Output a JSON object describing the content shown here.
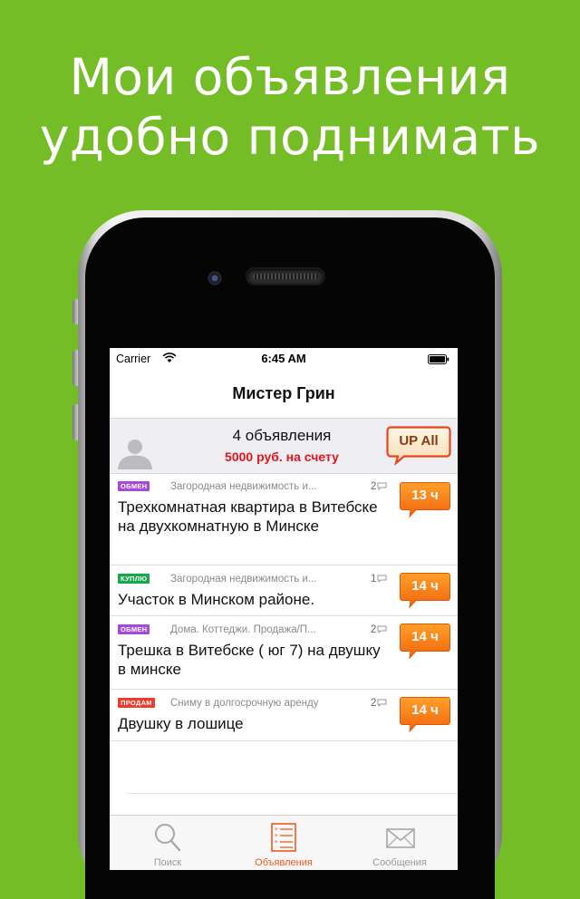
{
  "promo": {
    "line1": "Мои объявления",
    "line2": "удобно поднимать"
  },
  "status_bar": {
    "carrier": "Carrier",
    "time": "6:45 AM"
  },
  "nav": {
    "title": "Мистер Грин"
  },
  "profile": {
    "count": "4 объявления",
    "balance": "5000 руб. на счету",
    "up_all_label": "UP All"
  },
  "listings": [
    {
      "badge": "ОБМЕН",
      "badge_color": "#a54ad9",
      "category": "Загородная недвижимость и...",
      "comments": "2",
      "title": "Трехкомнатная квартира в Витебске на двухкомнатную в Минске",
      "hours": "13 ч"
    },
    {
      "badge": "КУПЛЮ",
      "badge_color": "#17a84d",
      "category": "Загородная недвижимость и...",
      "comments": "1",
      "title": "Участок в Минском районе.",
      "hours": "14 ч"
    },
    {
      "badge": "ОБМЕН",
      "badge_color": "#a54ad9",
      "category": "Дома. Коттеджи. Продажа/П...",
      "comments": "2",
      "title": "Трешка в Витебске ( юг 7) на двушку в минске",
      "hours": "14 ч"
    },
    {
      "badge": "ПРОДАМ",
      "badge_color": "#ef3b2c",
      "category": "Сниму в долгосрочную аренду",
      "comments": "2",
      "title": "Двушку в лошице",
      "hours": "14 ч"
    }
  ],
  "tabs": [
    {
      "label": "Поиск",
      "icon": "search-icon",
      "active": false
    },
    {
      "label": "Объявления",
      "icon": "list-icon",
      "active": true
    },
    {
      "label": "Сообщения",
      "icon": "envelope-icon",
      "active": false
    }
  ],
  "colors": {
    "background": "#74bd27",
    "accent": "#f2581e",
    "balance": "#e8141b",
    "hours_button": "#f57a10"
  }
}
